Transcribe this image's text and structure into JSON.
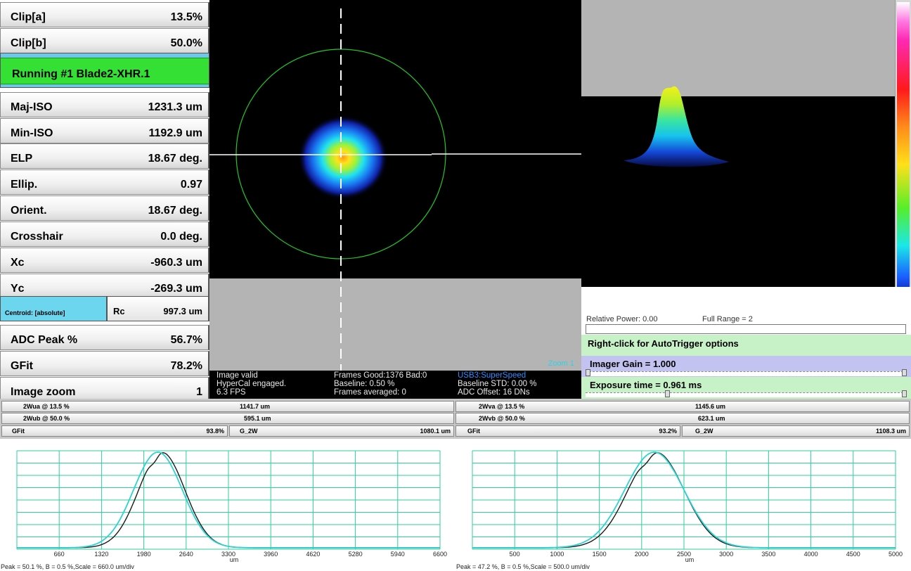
{
  "params": [
    {
      "label": "Clip[a]",
      "value": "13.5%"
    },
    {
      "label": "Clip[b]",
      "value": "50.0%"
    },
    {
      "label": "Maj-ISO",
      "value": "1231.3 um"
    },
    {
      "label": "Min-ISO",
      "value": "1192.9 um"
    },
    {
      "label": "ELP",
      "value": "18.67 deg."
    },
    {
      "label": "Ellip.",
      "value": "0.97"
    },
    {
      "label": "Orient.",
      "value": "18.67 deg."
    },
    {
      "label": "Crosshair",
      "value": "0.0 deg."
    },
    {
      "label": "Xc",
      "value": "-960.3 um"
    },
    {
      "label": "Yc",
      "value": "-269.3 um"
    },
    {
      "label": "ADC Peak %",
      "value": "56.7%"
    },
    {
      "label": "GFit",
      "value": "78.2%"
    },
    {
      "label": "Image zoom",
      "value": "1"
    }
  ],
  "status": {
    "text": "Running #1 Blade2-XHR.1",
    "color": "#33e033"
  },
  "centroid": {
    "mode": "Centroid: [absolute]",
    "rc_label": "Rc",
    "rc_value": "997.3 um"
  },
  "image_info": {
    "zoom": "Zoom 1",
    "col1": [
      "Image valid",
      "HyperCal engaged.",
      "6.3 FPS"
    ],
    "col2": [
      "Frames Good:1376 Bad:0",
      "Baseline: 0.50 %",
      "Frames averaged: 0"
    ],
    "usb": "USB3:SuperSpeed",
    "col3": [
      "Baseline STD: 0.00 %",
      "ADC Offset: 16 DNs"
    ]
  },
  "power": {
    "relative": "Relative Power: 0.00",
    "full_range": "Full Range = 2"
  },
  "controls": {
    "autotrigger": "Right-click for AutoTrigger options",
    "gain": "Imager Gain = 1.000",
    "gain_level": 0.0,
    "exposure": "Exposure time = 0.961 ms",
    "exposure_level": 0.25
  },
  "width_rows": {
    "left": [
      {
        "label": "2Wua @ 13.5 %",
        "value": "1141.7 um"
      },
      {
        "label": "2Wub @ 50.0 %",
        "value": "595.1 um"
      }
    ],
    "left_fit": {
      "label": "GFit",
      "value": "93.8%",
      "g_label": "G_2W",
      "g_value": "1080.1 um"
    },
    "right": [
      {
        "label": "2Wva @ 13.5 %",
        "value": "1145.6 um"
      },
      {
        "label": "2Wvb @ 50.0 %",
        "value": "623.1 um"
      }
    ],
    "right_fit": {
      "label": "GFit",
      "value": "93.2%",
      "g_label": "G_2W",
      "g_value": "1108.3 um"
    }
  },
  "chart_data": [
    {
      "type": "line",
      "x_ticks": [
        "660",
        "1320",
        "1980",
        "2640",
        "3300",
        "3960",
        "4620",
        "5280",
        "5940",
        "6600"
      ],
      "xlim": [
        0,
        6600
      ],
      "xlabel": "um",
      "footer": "Peak = 50.1 %, B = 0.5 %,Scale = 660.0 um/div",
      "series": [
        {
          "color": "#1a1a1a",
          "peak_x": 2260,
          "sigma": 360,
          "peak": 1.0
        },
        {
          "color": "#2fd2d2",
          "peak_x": 2200,
          "sigma": 380,
          "peak": 1.0
        }
      ]
    },
    {
      "type": "line",
      "x_ticks": [
        "500",
        "1000",
        "1500",
        "2000",
        "2500",
        "3000",
        "3500",
        "4000",
        "4500",
        "5000"
      ],
      "xlim": [
        0,
        5000
      ],
      "xlabel": "um",
      "footer": "Peak = 47.2 %, B = 0.5 %,Scale = 500.0 um/div",
      "series": [
        {
          "color": "#1a1a1a",
          "peak_x": 2170,
          "sigma": 330,
          "peak": 1.0
        },
        {
          "color": "#2fd2d2",
          "peak_x": 2150,
          "sigma": 350,
          "peak": 1.0
        }
      ]
    }
  ]
}
